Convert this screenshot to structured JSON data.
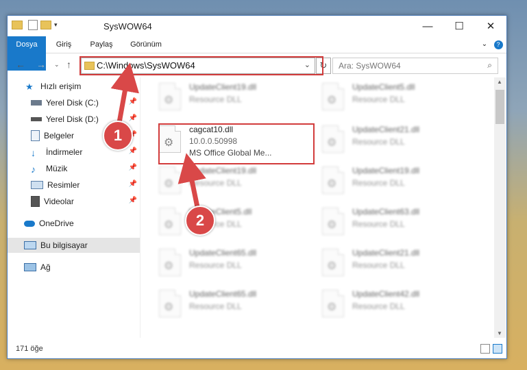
{
  "window": {
    "title": "SysWOW64"
  },
  "ribbon": {
    "tabs": [
      "Dosya",
      "Giriş",
      "Paylaş",
      "Görünüm"
    ]
  },
  "address": {
    "path": "C:\\Windows\\SysWOW64"
  },
  "search": {
    "placeholder": "Ara: SysWOW64"
  },
  "sidebar": {
    "items": [
      {
        "label": "Hızlı erişim",
        "icon": "star-icon"
      },
      {
        "label": "Yerel Disk (C:)",
        "icon": "drive-icon"
      },
      {
        "label": "Yerel Disk (D:)",
        "icon": "drive-icon"
      },
      {
        "label": "Belgeler",
        "icon": "documents-icon"
      },
      {
        "label": "İndirmeler",
        "icon": "download-icon"
      },
      {
        "label": "Müzik",
        "icon": "music-icon"
      },
      {
        "label": "Resimler",
        "icon": "pictures-icon"
      },
      {
        "label": "Videolar",
        "icon": "video-icon"
      },
      {
        "label": "OneDrive",
        "icon": "cloud-icon"
      },
      {
        "label": "Bu bilgisayar",
        "icon": "computer-icon"
      },
      {
        "label": "Ağ",
        "icon": "network-icon"
      }
    ]
  },
  "files": {
    "highlight": {
      "name": "cagcat10.dll",
      "version": "10.0.0.50998",
      "description": "MS Office Global Me..."
    },
    "left": [
      {
        "name": "UpdateClient19.dll",
        "type": "Resource DLL"
      },
      {
        "name": "UpdateClient19.dll",
        "type": "Resource DLL"
      },
      {
        "name": "UpdateClient5.dll",
        "type": "Resource DLL"
      },
      {
        "name": "UpdateClient65.dll",
        "type": "Resource DLL"
      },
      {
        "name": "UpdateClient65.dll",
        "type": "Resource DLL"
      }
    ],
    "right": [
      {
        "name": "UpdateClient5.dll",
        "type": "Resource DLL"
      },
      {
        "name": "UpdateClient21.dll",
        "type": "Resource DLL"
      },
      {
        "name": "UpdateClient19.dll",
        "type": "Resource DLL"
      },
      {
        "name": "UpdateClient63.dll",
        "type": "Resource DLL"
      },
      {
        "name": "UpdateClient21.dll",
        "type": "Resource DLL"
      },
      {
        "name": "UpdateClient42.dll",
        "type": "Resource DLL"
      }
    ]
  },
  "status": {
    "count": "171 öğe"
  },
  "badges": {
    "one": "1",
    "two": "2"
  },
  "colors": {
    "accent": "#1979ca",
    "highlight": "#d23b3b"
  }
}
